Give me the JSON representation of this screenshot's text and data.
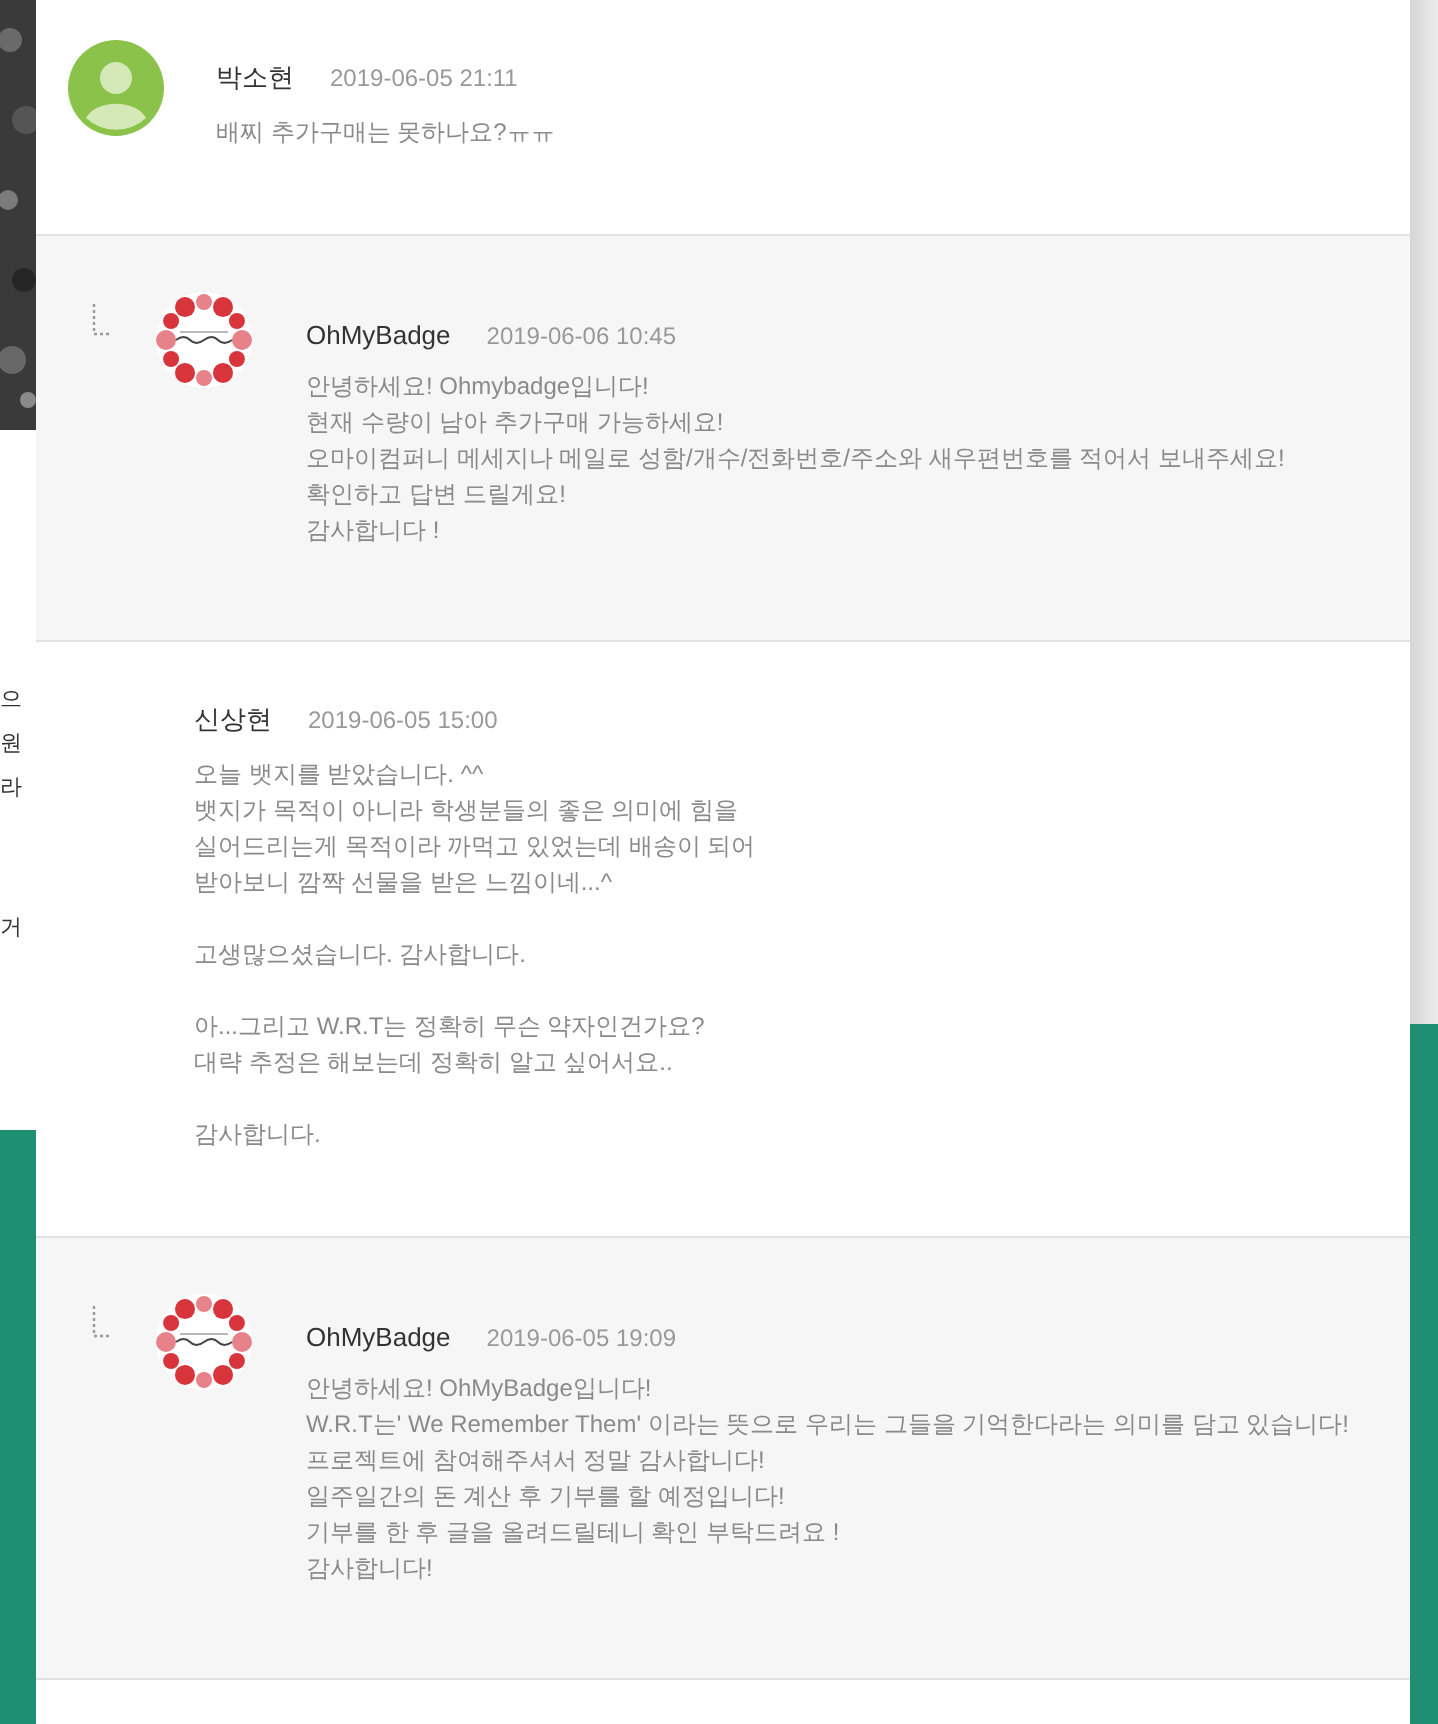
{
  "background": {
    "fragments": [
      "으",
      "원",
      "라",
      "거"
    ]
  },
  "comments": [
    {
      "kind": "comment",
      "avatar": {
        "kind": "person"
      },
      "author": "박소현",
      "date": "2019-06-05 21:11",
      "paragraphs": [
        "배찌 추가구매는 못하나요?ㅠㅠ"
      ]
    },
    {
      "kind": "reply",
      "avatar": {
        "kind": "wreath"
      },
      "author": "OhMyBadge",
      "date": "2019-06-06 10:45",
      "paragraphs": [
        "안녕하세요! Ohmybadge입니다!\n현재 수량이 남아 추가구매 가능하세요!\n오마이컴퍼니 메세지나 메일로 성함/개수/전화번호/주소와 새우편번호를 적어서 보내주세요!\n확인하고 답변 드릴게요!\n감사합니다 !"
      ]
    },
    {
      "kind": "comment",
      "author": "신상현",
      "date": "2019-06-05 15:00",
      "paragraphs": [
        "오늘 뱃지를 받았습니다. ^^\n뱃지가 목적이 아니라 학생분들의 좋은 의미에 힘을\n실어드리는게 목적이라 까먹고 있었는데 배송이 되어\n받아보니 깜짝 선물을 받은 느낌이네...^",
        "고생많으셨습니다. 감사합니다.",
        "아...그리고 W.R.T는 정확히 무슨 약자인건가요?\n대략 추정은 해보는데 정확히 알고 싶어서요..",
        "감사합니다."
      ]
    },
    {
      "kind": "reply",
      "avatar": {
        "kind": "wreath"
      },
      "author": "OhMyBadge",
      "date": "2019-06-05 19:09",
      "paragraphs": [
        "안녕하세요! OhMyBadge입니다!\nW.R.T는' We Remember Them' 이라는 뜻으로 우리는 그들을 기억한다라는 의미를 담고 있습니다!\n프로젝트에 참여해주셔서 정말 감사합니다!\n일주일간의 돈 계산 후 기부를 할 예정입니다!\n기부를 한 후 글을 올려드릴테니 확인 부탁드려요 !\n감사합니다!"
      ]
    }
  ]
}
